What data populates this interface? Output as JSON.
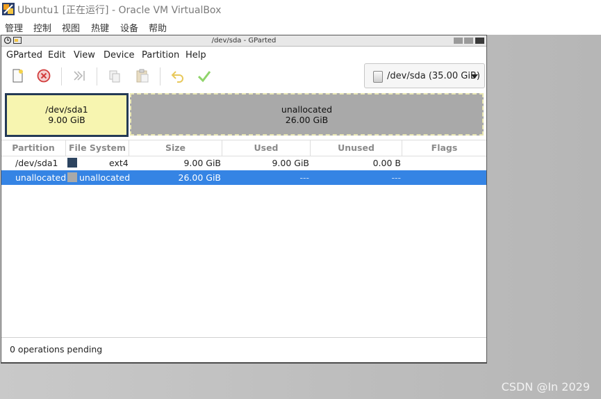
{
  "vbox": {
    "title": "Ubuntu1 [正在运行] - Oracle VM VirtualBox",
    "menu": [
      "管理",
      "控制",
      "视图",
      "热键",
      "设备",
      "帮助"
    ]
  },
  "gparted": {
    "window_title": "/dev/sda - GParted",
    "menu": [
      "GParted",
      "Edit",
      "View",
      "Device",
      "Partition",
      "Help"
    ],
    "toolbar": [
      {
        "icon": "new-partition-icon",
        "enabled": true
      },
      {
        "icon": "delete-icon",
        "enabled": true
      },
      {
        "icon": "resize-move-icon",
        "enabled": false
      },
      {
        "icon": "copy-icon",
        "enabled": false
      },
      {
        "icon": "paste-icon",
        "enabled": false
      },
      {
        "icon": "undo-icon",
        "enabled": false
      },
      {
        "icon": "apply-icon",
        "enabled": false
      }
    ],
    "device_selector": "/dev/sda (35.00 GiB)",
    "partition_map": {
      "sda1": {
        "name": "/dev/sda1",
        "size": "9.00 GiB",
        "color": "#f7f5b0",
        "border": "#243a56"
      },
      "unallocated": {
        "name": "unallocated",
        "size": "26.00 GiB",
        "color": "#a9a9a9"
      }
    },
    "columns": [
      "Partition",
      "File System",
      "Size",
      "Used",
      "Unused",
      "Flags"
    ],
    "rows": [
      {
        "partition": "/dev/sda1",
        "fs": "ext4",
        "fs_color": "#2c4460",
        "size": "9.00 GiB",
        "used": "9.00 GiB",
        "unused": "0.00 B",
        "flags": "",
        "selected": false
      },
      {
        "partition": "unallocated",
        "fs": "unallocated",
        "fs_color": "#a9a9a9",
        "size": "26.00 GiB",
        "used": "---",
        "unused": "---",
        "flags": "",
        "selected": true
      }
    ],
    "status": "0 operations pending",
    "selection_color": "#3584e4"
  },
  "watermark": "CSDN @In 2029"
}
